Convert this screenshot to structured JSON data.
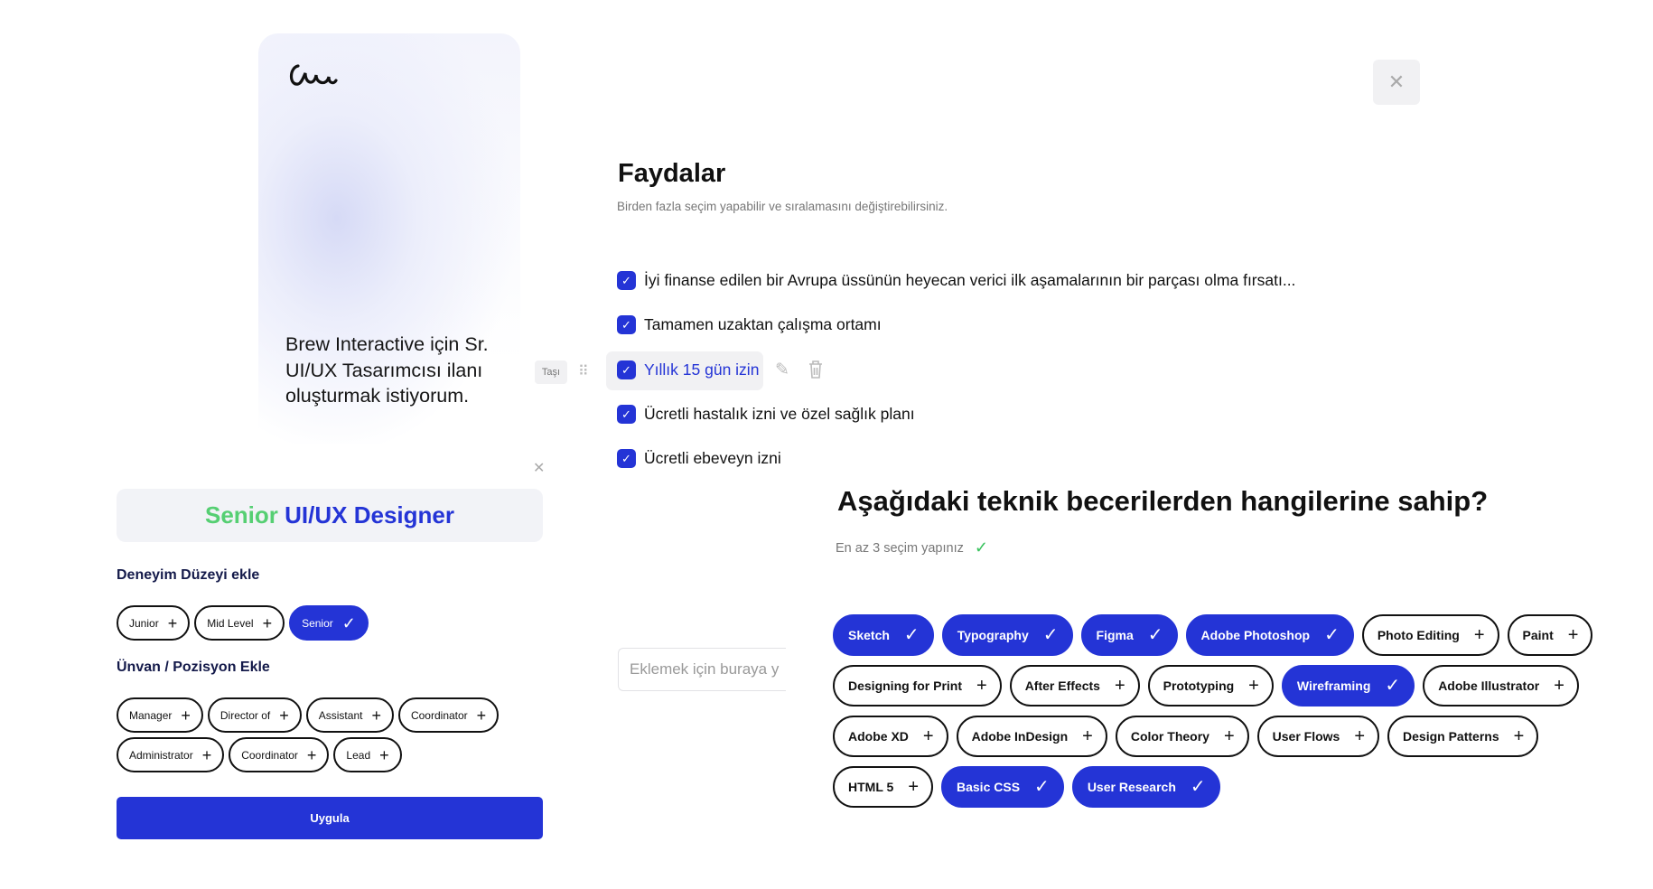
{
  "colors": {
    "accent": "#2434d6",
    "green": "#56cf73",
    "check": "#38c25c"
  },
  "hero": {
    "logo": "ce",
    "text": "Brew Interactive için Sr. UI/UX Tasarımcısı ilanı oluşturmak istiyorum."
  },
  "job": {
    "title_level": "Senior",
    "title_role": "UI/UX Designer"
  },
  "experience": {
    "heading": "Deneyim Düzeyi ekle",
    "chips": [
      {
        "label": "Junior",
        "selected": false
      },
      {
        "label": "Mid Level",
        "selected": false
      },
      {
        "label": "Senior",
        "selected": true
      }
    ]
  },
  "position": {
    "heading": "Ünvan / Pozisyon Ekle",
    "rows": [
      [
        {
          "label": "Manager",
          "selected": false
        },
        {
          "label": "Director of",
          "selected": false
        },
        {
          "label": "Assistant",
          "selected": false
        },
        {
          "label": "Coordinator",
          "selected": false
        }
      ],
      [
        {
          "label": "Administrator",
          "selected": false
        },
        {
          "label": "Coordinator",
          "selected": false
        },
        {
          "label": "Lead",
          "selected": false
        }
      ]
    ]
  },
  "apply_label": "Uygula",
  "benefits": {
    "title": "Faydalar",
    "subtitle": "Birden fazla seçim yapabilir ve sıralamasını değiştirebilirsiniz.",
    "move_label": "Taşı",
    "items": [
      {
        "label": "İyi finanse edilen bir Avrupa üssünün heyecan verici ilk aşamalarının bir parçası olma fırsatı...",
        "checked": true
      },
      {
        "label": "Tamamen uzaktan çalışma ortamı",
        "checked": true
      },
      {
        "label": "Yıllık 15 gün izin",
        "checked": true,
        "active": true
      },
      {
        "label": "Ücretli hastalık izni ve özel sağlık planı",
        "checked": true
      },
      {
        "label": "Ücretli ebeveyn izni",
        "checked": true
      }
    ],
    "input_placeholder": "Eklemek için buraya y"
  },
  "skills": {
    "heading": "Aşağıdaki teknik becerilerden hangilerine sahip?",
    "hint": "En az 3 seçim yapınız",
    "rows": [
      [
        {
          "label": "Sketch",
          "selected": true
        },
        {
          "label": "Typography",
          "selected": true
        },
        {
          "label": "Figma",
          "selected": true
        },
        {
          "label": "Adobe Photoshop",
          "selected": true
        },
        {
          "label": "Photo Editing",
          "selected": false
        },
        {
          "label": "Paint",
          "selected": false
        }
      ],
      [
        {
          "label": "Designing for Print",
          "selected": false
        },
        {
          "label": "After Effects",
          "selected": false
        },
        {
          "label": "Prototyping",
          "selected": false
        },
        {
          "label": "Wireframing",
          "selected": true
        },
        {
          "label": "Adobe Illustrator",
          "selected": false
        }
      ],
      [
        {
          "label": "Adobe XD",
          "selected": false
        },
        {
          "label": "Adobe InDesign",
          "selected": false
        },
        {
          "label": "Color Theory",
          "selected": false
        },
        {
          "label": "User Flows",
          "selected": false
        },
        {
          "label": "Design Patterns",
          "selected": false
        }
      ],
      [
        {
          "label": "HTML 5",
          "selected": false
        },
        {
          "label": "Basic CSS",
          "selected": true
        },
        {
          "label": "User Research",
          "selected": true
        }
      ]
    ]
  }
}
